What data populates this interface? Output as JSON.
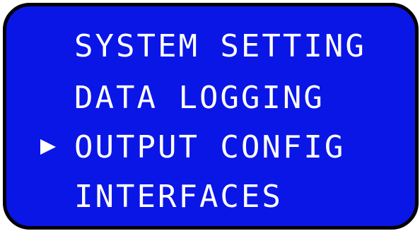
{
  "menu": {
    "items": [
      {
        "label": "SYSTEM SETTING",
        "selected": false
      },
      {
        "label": "DATA LOGGING",
        "selected": false
      },
      {
        "label": "OUTPUT CONFIG",
        "selected": true
      },
      {
        "label": "INTERFACES",
        "selected": false
      }
    ],
    "cursor_glyph": "▶"
  },
  "colors": {
    "screen_background": "#0a16e6",
    "text": "#ffffff",
    "bezel": "#000000"
  }
}
